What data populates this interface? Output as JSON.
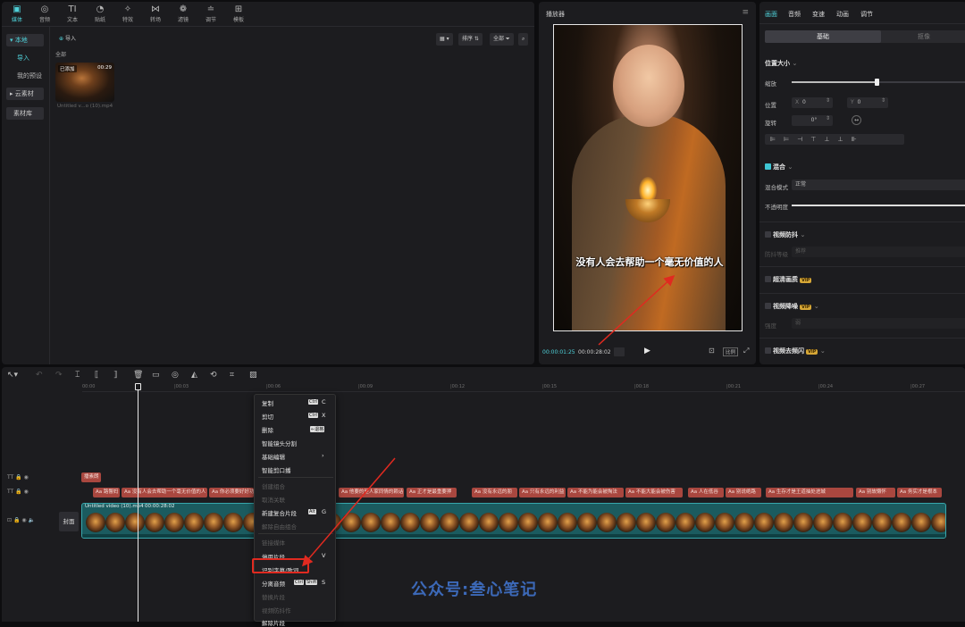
{
  "top_tools": [
    {
      "label": "媒体",
      "icon": "media-icon"
    },
    {
      "label": "音频",
      "icon": "audio-icon"
    },
    {
      "label": "文本",
      "icon": "text-icon"
    },
    {
      "label": "贴纸",
      "icon": "sticker-icon"
    },
    {
      "label": "特效",
      "icon": "effects-icon"
    },
    {
      "label": "转场",
      "icon": "transition-icon"
    },
    {
      "label": "滤镜",
      "icon": "filter-icon"
    },
    {
      "label": "调节",
      "icon": "adjust-icon"
    },
    {
      "label": "模板",
      "icon": "template-icon"
    }
  ],
  "left_nav": {
    "local": "▾ 本地",
    "import": "导入",
    "presets": "我的预设",
    "cloud": "▸ 云素材",
    "library": "素材库"
  },
  "media": {
    "import_button": "导入",
    "all_label": "全部",
    "sort": "排序",
    "filter": "全部",
    "thumb_badge": "已添加",
    "thumb_duration": "00:29",
    "thumb_filename": "Untitled v...o (10).mp4"
  },
  "player": {
    "title": "播放器",
    "subtitle": "没有人会去帮助一个毫无价值的人",
    "current_time": "00:00:01:25",
    "total_time": "00:00:28:02",
    "ratio_button": "比例"
  },
  "attrs": {
    "tabs": [
      "画面",
      "音频",
      "变速",
      "动画",
      "调节"
    ],
    "seg_basic": "基础",
    "seg_mask": "抠像",
    "position_size": "位置大小",
    "scale": "缩放",
    "position": "位置",
    "x_label": "X",
    "x_value": "0",
    "y_label": "Y",
    "y_value": "0",
    "rotate": "旋转",
    "rotate_value": "0°",
    "mix": "混合",
    "blend_mode": "混合模式",
    "blend_value": "正常",
    "opacity": "不透明度",
    "stabilize": "视频防抖",
    "stabilize_level": "防抖等级",
    "stabilize_value": "推荐",
    "hd": "超清画质",
    "denoise": "视频降噪",
    "denoise_strength": "强度",
    "denoise_value": "弱",
    "deflicker": "视频去频闪",
    "vip": "VIP",
    "scale_fraction": 0.75
  },
  "timeline": {
    "ticks": [
      "00:00",
      "|00:03",
      "|00:06",
      "|00:09",
      "|00:12",
      "|00:15",
      "|00:18",
      "|00:21",
      "|00:24",
      "|00:27"
    ],
    "track_text_label": "TT",
    "cover_label": "封面",
    "clip_title": "Untitled video (10).mp4",
    "clip_duration": "00:00:28:02",
    "subtitle_short": "播素朗",
    "subtitle_clips": [
      "Aa 路瞥妈",
      "Aa 没有人会去帮助一个毫无价值的人",
      "Aa 你必须要好好功",
      "Aa 他要的是人家同情的赖话",
      "Aa 正才是最重要狎",
      "Aa 没有永远的朋",
      "Aa 只有永远的利益",
      "Aa 不能为能会被掏法",
      "Aa 不能大能会被伤害",
      "Aa 人在低谷",
      "Aa 别说绝路",
      "Aa 生存才是王道抽处进城",
      "Aa 别故懒怀",
      "Aa 务实才是根本"
    ]
  },
  "context_menu": {
    "copy": "复制",
    "copy_key": "C",
    "cut": "剪切",
    "cut_key": "X",
    "delete": "删除",
    "delete_key": "←退格",
    "smart_split": "智能镜头分割",
    "basic_edit": "基础编辑",
    "smart_crop": "智能剪口播",
    "create_group": "创建组合",
    "unlink": "取消关联",
    "new_compound": "新建复合片段",
    "new_compound_key": "G",
    "unknown1": "解除自由组合",
    "unknown2": "链接媒体",
    "disable": "停用片段",
    "disable_key": "V",
    "recognize": "识别字幕/歌词",
    "separate_audio": "分离音频",
    "separate_key": "S",
    "replace": "替换片段",
    "locate": "视频防抖作",
    "more": "解除片段",
    "ctrl": "Ctrl",
    "shift": "Shift",
    "alt": "Alt"
  },
  "watermark": "公众号:叁心笔记",
  "colors": {
    "accent": "#4fd1d9",
    "subtitle_clip": "#a9473f",
    "video_clip": "#1b5b5f",
    "highlight": "#e02a20"
  }
}
